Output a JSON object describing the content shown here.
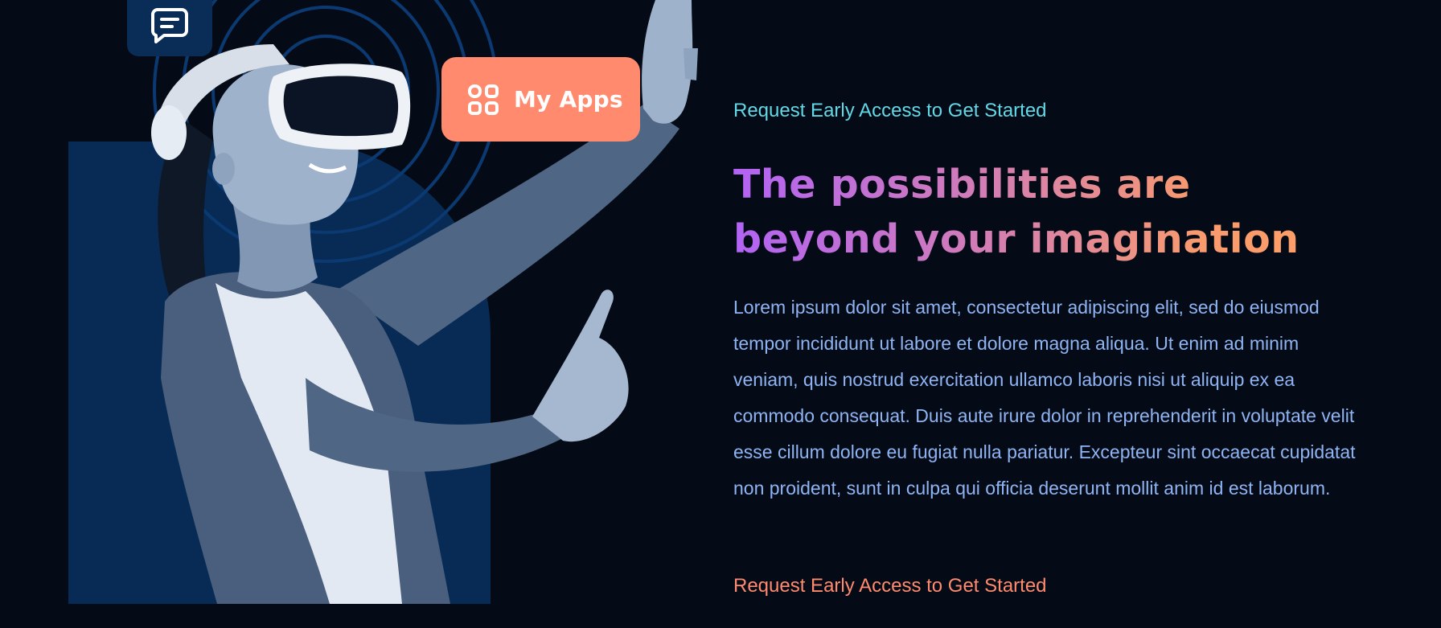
{
  "colors": {
    "background": "#050b16",
    "panel": "#082b55",
    "accent_coral": "#ff8a6e",
    "eyebrow_cyan": "#62d8e6",
    "body_blue": "#8fb4f4",
    "gradient_start": "#b263f4",
    "gradient_end": "#ff9e66"
  },
  "visual": {
    "chat_icon": "chat-bubble-icon",
    "apps_button": {
      "icon": "grid-apps-icon",
      "label": "My Apps"
    }
  },
  "content": {
    "eyebrow": "Request Early Access to Get Started",
    "headline_line1": "The possibilities are",
    "headline_line2": "beyond your imagination",
    "body": "Lorem ipsum dolor sit amet, consectetur adipiscing elit, sed do eiusmod tempor incididunt ut labore et dolore magna aliqua. Ut enim ad minim veniam, quis nostrud exercitation ullamco laboris nisi ut aliquip ex ea commodo consequat. Duis aute irure dolor in reprehenderit in voluptate velit esse cillum dolore eu fugiat nulla pariatur. Excepteur sint occaecat cupidatat non proident, sunt in culpa qui officia deserunt mollit anim id est laborum.",
    "cta": "Request Early Access to Get Started"
  }
}
